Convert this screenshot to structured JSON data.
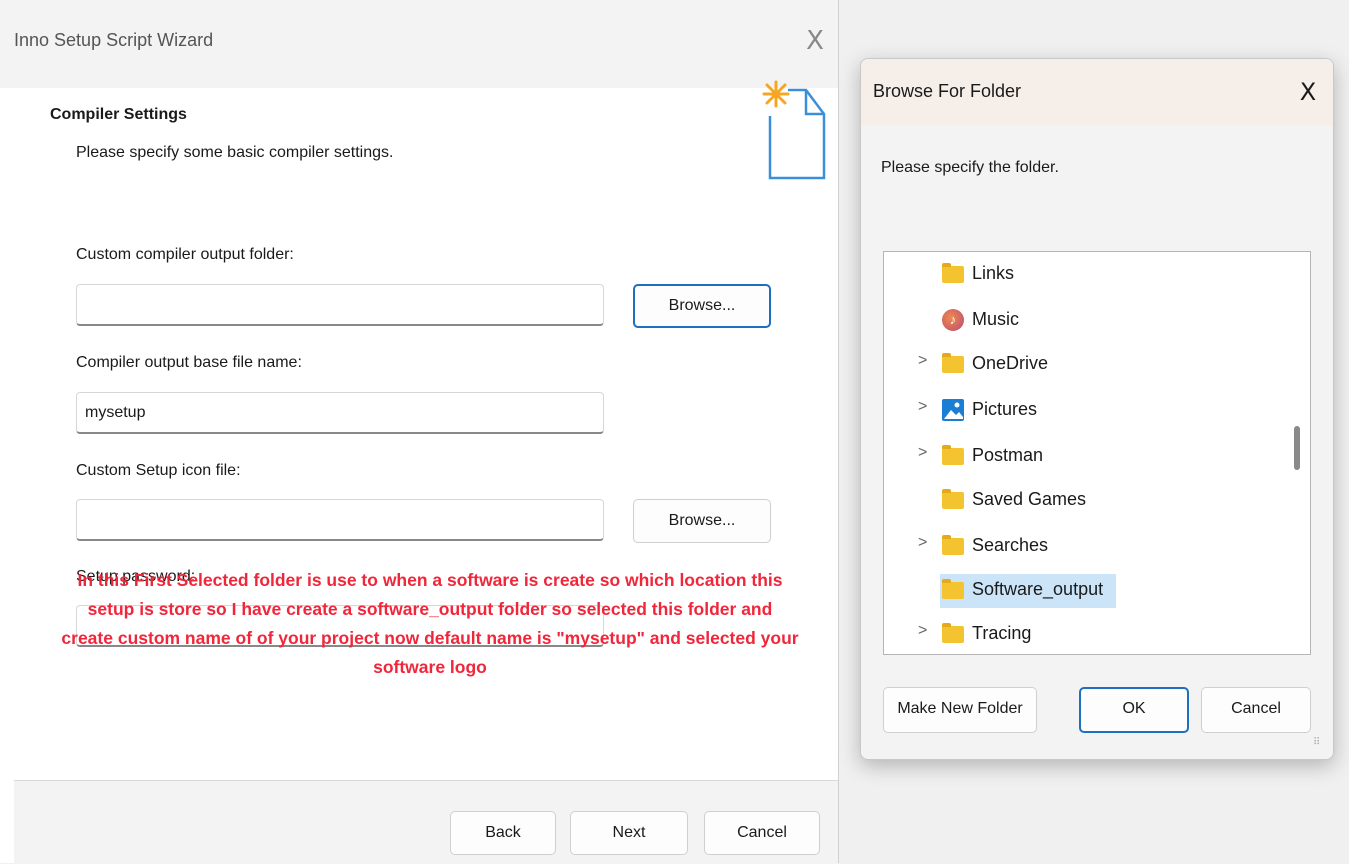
{
  "wizard": {
    "title": "Inno Setup Script Wizard",
    "close_glyph": "X",
    "section_title": "Compiler Settings",
    "section_subtitle": "Please specify some basic compiler settings.",
    "fields": {
      "output_folder_label": "Custom compiler output folder:",
      "output_folder_value": "",
      "base_name_label": "Compiler output base file name:",
      "base_name_value": "mysetup",
      "icon_file_label": "Custom Setup icon file:",
      "icon_file_value": "",
      "password_label": "Setup password:",
      "password_value": ""
    },
    "browse_label": "Browse...",
    "note": "In this First Selected folder is use to when a software is create so which location this setup is store so I have create a software_output folder so selected this folder and create custom name of of your project now default name is \"mysetup\" and selected your software logo",
    "footer": {
      "back": "Back",
      "next": "Next",
      "cancel": "Cancel"
    }
  },
  "browse_dialog": {
    "title": "Browse For Folder",
    "close_glyph": "X",
    "prompt": "Please specify the folder.",
    "tree": [
      {
        "label": "Links",
        "icon": "folder-icon",
        "expandable": false
      },
      {
        "label": "Music",
        "icon": "music-icon",
        "expandable": false
      },
      {
        "label": "OneDrive",
        "icon": "folder-icon",
        "expandable": true
      },
      {
        "label": "Pictures",
        "icon": "pictures-icon",
        "expandable": true
      },
      {
        "label": "Postman",
        "icon": "folder-icon",
        "expandable": true
      },
      {
        "label": "Saved Games",
        "icon": "folder-icon",
        "expandable": false
      },
      {
        "label": "Searches",
        "icon": "folder-icon",
        "expandable": true
      },
      {
        "label": "Software_output",
        "icon": "folder-icon",
        "expandable": false,
        "selected": true
      },
      {
        "label": "Tracing",
        "icon": "folder-icon",
        "expandable": true
      }
    ],
    "chevron_glyph": ">",
    "make_new_folder": "Make New Folder",
    "ok": "OK",
    "cancel": "Cancel"
  },
  "colors": {
    "note_red": "#f0273b",
    "selection": "#cce4f7",
    "focus_blue": "#1f6fc1",
    "folder_yellow": "#f4c430"
  }
}
